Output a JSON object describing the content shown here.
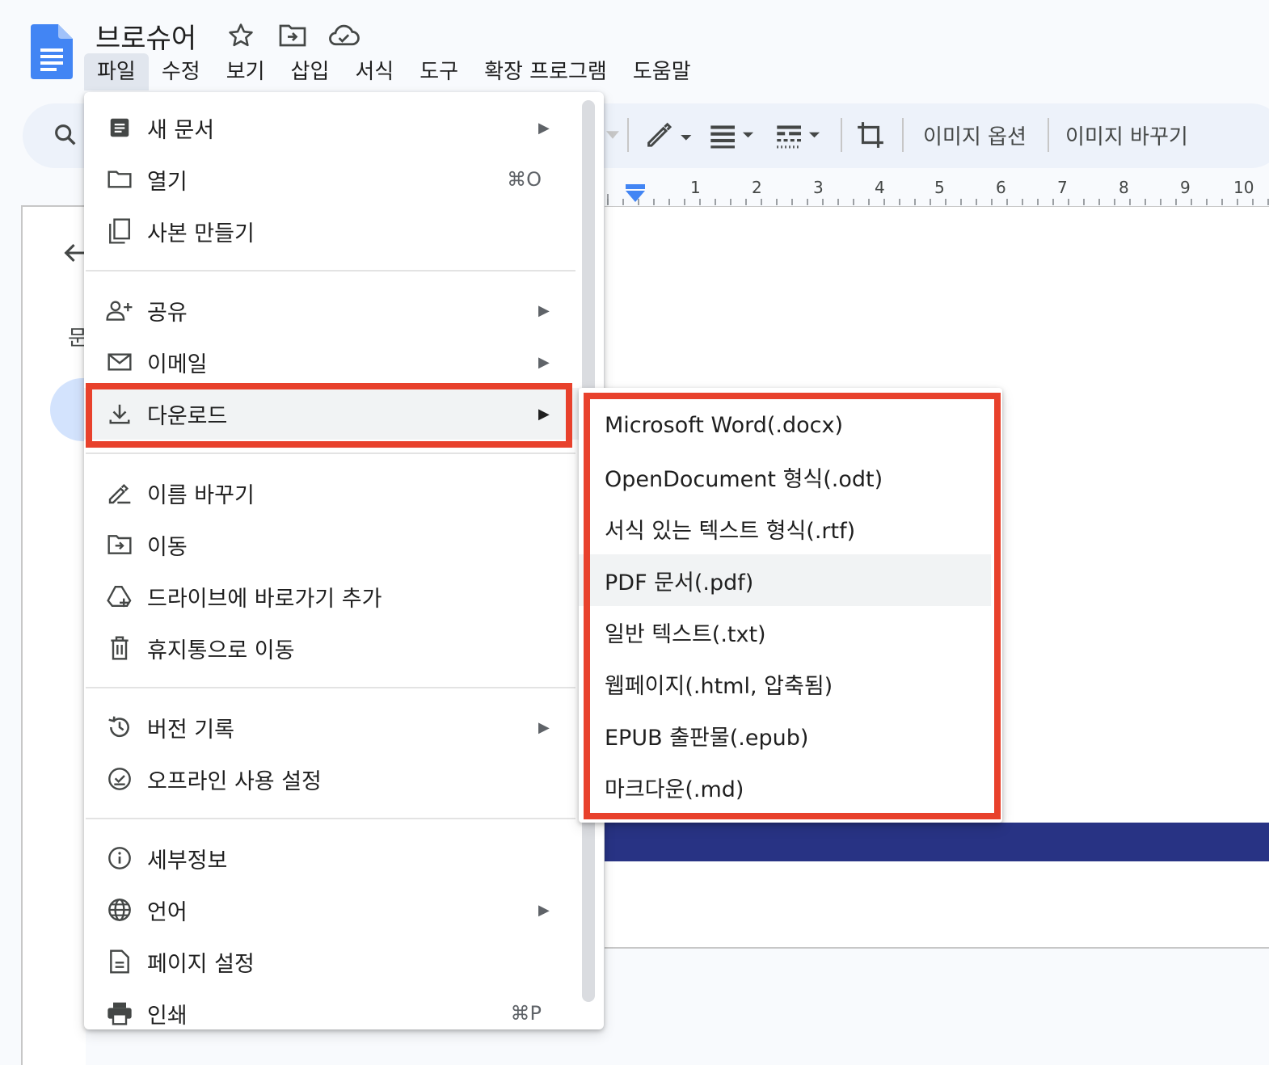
{
  "document": {
    "title": "브로슈어"
  },
  "menubar": {
    "items": [
      "파일",
      "수정",
      "보기",
      "삽입",
      "서식",
      "도구",
      "확장 프로그램",
      "도움말"
    ]
  },
  "toolbar": {
    "image_options": "이미지 옵션",
    "replace_image": "이미지 바꾸기"
  },
  "ruler": {
    "ticks": [
      "1",
      "2",
      "3",
      "4",
      "5",
      "6",
      "7",
      "8",
      "9",
      "10"
    ]
  },
  "left_panel": {
    "partial_char": "문"
  },
  "file_menu": {
    "items": [
      {
        "label": "새 문서",
        "icon": "new-document-icon",
        "submenu": true
      },
      {
        "label": "열기",
        "icon": "folder-open-icon",
        "shortcut": "⌘O"
      },
      {
        "label": "사본 만들기",
        "icon": "copy-icon"
      },
      {
        "label": "공유",
        "icon": "share-person-add-icon",
        "submenu": true
      },
      {
        "label": "이메일",
        "icon": "email-icon",
        "submenu": true
      },
      {
        "label": "다운로드",
        "icon": "download-icon",
        "submenu": true,
        "highlighted": true
      },
      {
        "label": "이름 바꾸기",
        "icon": "rename-icon"
      },
      {
        "label": "이동",
        "icon": "move-folder-icon"
      },
      {
        "label": "드라이브에 바로가기 추가",
        "icon": "drive-shortcut-icon"
      },
      {
        "label": "휴지통으로 이동",
        "icon": "trash-icon"
      },
      {
        "label": "버전 기록",
        "icon": "version-history-icon",
        "submenu": true
      },
      {
        "label": "오프라인 사용 설정",
        "icon": "offline-check-icon"
      },
      {
        "label": "세부정보",
        "icon": "info-icon"
      },
      {
        "label": "언어",
        "icon": "globe-icon",
        "submenu": true
      },
      {
        "label": "페이지 설정",
        "icon": "page-setup-icon"
      },
      {
        "label": "인쇄",
        "icon": "printer-icon",
        "shortcut": "⌘P"
      }
    ]
  },
  "download_submenu": {
    "items": [
      "Microsoft Word(.docx)",
      "OpenDocument 형식(.odt)",
      "서식 있는 텍스트 형식(.rtf)",
      "PDF 문서(.pdf)",
      "일반 텍스트(.txt)",
      "웹페이지(.html, 압축됨)",
      "EPUB 출판물(.epub)",
      "마크다운(.md)"
    ],
    "hovered": "PDF 문서(.pdf)"
  },
  "colors": {
    "highlight_red": "#e8412c",
    "docs_blue": "#4285f4",
    "navy_band": "#283384"
  }
}
